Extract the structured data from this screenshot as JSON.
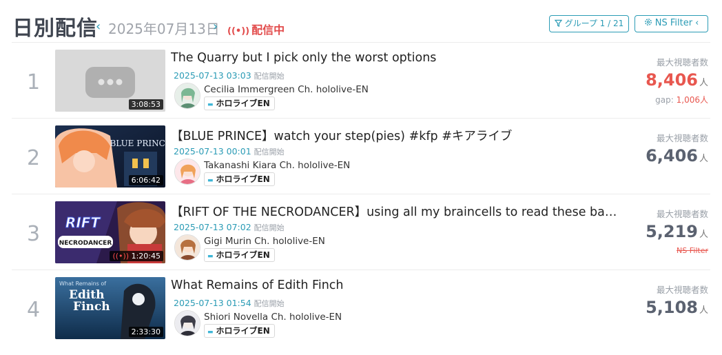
{
  "header": {
    "title": "日別配信",
    "prev": "‹",
    "date": "2025年07月13日",
    "next": "›",
    "live_text": "配信中",
    "group_button": "グループ 1 / 21",
    "ns_button": "NS Filter ‹"
  },
  "labels": {
    "max_viewers": "最大視聴者数",
    "unit": "人",
    "stream_start": "配信開始",
    "gap_label": "gap:",
    "ns_filter": "NS Filter"
  },
  "streams": [
    {
      "rank": "1",
      "duration": "3:08:53",
      "title": "The Quarry but I pick only the worst options",
      "start": "2025-07-13 03:03",
      "channel": "Cecilia Immergreen Ch. hololive-EN",
      "badge": "ホロライブEN",
      "viewers": "8,406",
      "gap": "1,006"
    },
    {
      "rank": "2",
      "duration": "6:06:42",
      "title": "【BLUE PRINCE】watch your step(pies) #kfp #キアライブ",
      "start": "2025-07-13 00:01",
      "channel": "Takanashi Kiara Ch. hololive-EN",
      "badge": "ホロライブEN",
      "viewers": "6,406"
    },
    {
      "rank": "3",
      "duration": "1:20:45",
      "title": "【RIFT OF THE NECRODANCER】using all my braincells to read these bats a…",
      "start": "2025-07-13 07:02",
      "channel": "Gigi Murin Ch. hololive-EN",
      "badge": "ホロライブEN",
      "viewers": "5,219"
    },
    {
      "rank": "4",
      "duration": "2:33:30",
      "title": "What Remains of Edith Finch",
      "start": "2025-07-13 01:54",
      "channel": "Shiori Novella Ch. hololive-EN",
      "badge": "ホロライブEN",
      "viewers": "5,108"
    }
  ],
  "thumb_text": {
    "t2": "BLUE PRINCE",
    "t3a": "RIFT",
    "t3b": "NECRODANCER",
    "t4a": "What Remains of",
    "t4b": "Edith",
    "t4c": "Finch"
  },
  "colors": {
    "accent": "#2a9bb5",
    "live_red": "#e24b4b",
    "hot_count": "#e8574f"
  }
}
